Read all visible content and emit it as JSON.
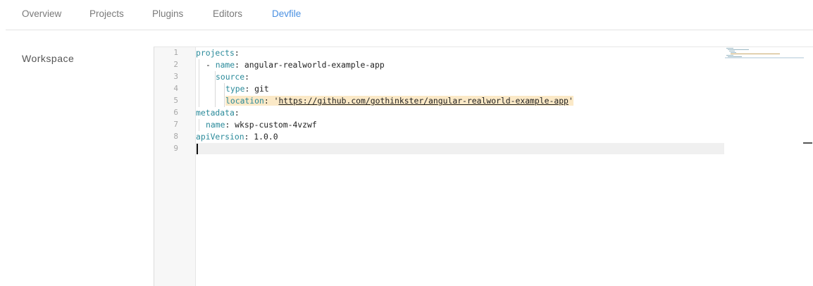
{
  "tabs": [
    {
      "label": "Overview"
    },
    {
      "label": "Projects"
    },
    {
      "label": "Plugins"
    },
    {
      "label": "Editors"
    },
    {
      "label": "Devfile"
    }
  ],
  "active_tab": "Devfile",
  "section": {
    "label": "Workspace"
  },
  "editor": {
    "line_numbers": [
      "1",
      "2",
      "3",
      "4",
      "5",
      "6",
      "7",
      "8",
      "9"
    ],
    "lines": [
      {
        "key": "projects",
        "sep": ":",
        "value": ""
      },
      {
        "prefix": "- ",
        "key": "name",
        "sep": ": ",
        "value": "angular-realworld-example-app"
      },
      {
        "key": "source",
        "sep": ":",
        "value": ""
      },
      {
        "key": "type",
        "sep": ": ",
        "value": "git"
      },
      {
        "key": "location",
        "sep": ": ",
        "quote_open": "'",
        "value": "https://github.com/gothinkster/angular-realworld-example-app",
        "quote_close": "'"
      },
      {
        "key": "metadata",
        "sep": ":",
        "value": ""
      },
      {
        "key": "name",
        "sep": ": ",
        "value": "wksp-custom-4vzwf"
      },
      {
        "key": "apiVersion",
        "sep": ": ",
        "value": "1.0.0"
      },
      {
        "value": ""
      }
    ]
  },
  "colors": {
    "accent": "#4a90e2",
    "yaml_key": "#2a8a9a",
    "highlight": "#fbe9c7"
  }
}
